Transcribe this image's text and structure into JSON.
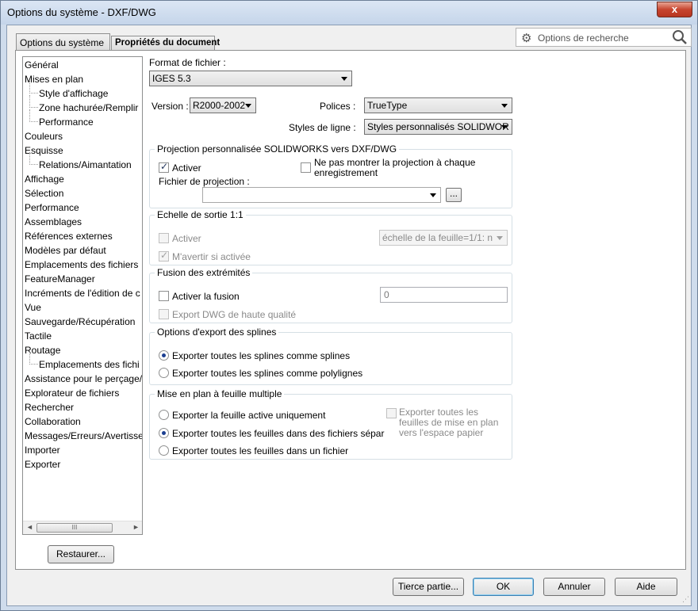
{
  "window": {
    "title": "Options du système - DXF/DWG",
    "close_symbol": "x"
  },
  "tabs": [
    {
      "label": "Options du système",
      "active": true
    },
    {
      "label": "Propriétés du document",
      "active": false
    }
  ],
  "search": {
    "label": "Options de recherche"
  },
  "tree": [
    {
      "label": "Général",
      "child": false
    },
    {
      "label": "Mises en plan",
      "child": false
    },
    {
      "label": "Style d'affichage",
      "child": true
    },
    {
      "label": "Zone hachurée/Remplir",
      "child": true
    },
    {
      "label": "Performance",
      "child": true
    },
    {
      "label": "Couleurs",
      "child": false
    },
    {
      "label": "Esquisse",
      "child": false
    },
    {
      "label": "Relations/Aimantation",
      "child": true
    },
    {
      "label": "Affichage",
      "child": false
    },
    {
      "label": "Sélection",
      "child": false
    },
    {
      "label": "Performance",
      "child": false
    },
    {
      "label": "Assemblages",
      "child": false
    },
    {
      "label": "Références externes",
      "child": false
    },
    {
      "label": "Modèles par défaut",
      "child": false
    },
    {
      "label": "Emplacements des fichiers",
      "child": false
    },
    {
      "label": "FeatureManager",
      "child": false
    },
    {
      "label": "Incréments de l'édition de c",
      "child": false
    },
    {
      "label": "Vue",
      "child": false
    },
    {
      "label": "Sauvegarde/Récupération",
      "child": false
    },
    {
      "label": "Tactile",
      "child": false
    },
    {
      "label": "Routage",
      "child": false
    },
    {
      "label": "Emplacements des fichi",
      "child": true
    },
    {
      "label": "Assistance pour le perçage/",
      "child": false
    },
    {
      "label": "Explorateur de fichiers",
      "child": false
    },
    {
      "label": "Rechercher",
      "child": false
    },
    {
      "label": "Collaboration",
      "child": false
    },
    {
      "label": "Messages/Erreurs/Avertisser",
      "child": false
    },
    {
      "label": "Importer",
      "child": false
    },
    {
      "label": "Exporter",
      "child": false
    }
  ],
  "scroll": {
    "left": "◄",
    "right": "►",
    "grip": "III"
  },
  "restore_button": "Restaurer...",
  "format": {
    "label": "Format de fichier :",
    "value": "IGES 5.3"
  },
  "version": {
    "label": "Version :",
    "value": "R2000-2002"
  },
  "fonts": {
    "label": "Polices :",
    "value": "TrueType"
  },
  "line_styles": {
    "label": "Styles de ligne :",
    "value": "Styles personnalisés SOLIDWOR"
  },
  "projection": {
    "title": "Projection personnalisée SOLIDWORKS vers DXF/DWG",
    "activate": "Activer",
    "no_show_line1": "Ne pas montrer la projection à chaque",
    "no_show_line2": "enregistrement",
    "file_label": "Fichier de projection :",
    "file_value": "",
    "browse": "..."
  },
  "scale": {
    "title": "Echelle de sortie 1:1",
    "activate": "Activer",
    "warn": "M'avertir si activée",
    "combo": "échelle de la feuille=1/1: n"
  },
  "merge": {
    "title": "Fusion des extrémités",
    "activate": "Activer la fusion",
    "value": "0",
    "hq_export": "Export DWG de haute qualité"
  },
  "splines": {
    "title": "Options d'export des splines",
    "opt1": "Exporter toutes les splines comme splines",
    "opt2": "Exporter toutes les splines comme polylignes"
  },
  "multisheet": {
    "title": "Mise en plan à feuille multiple",
    "opt1": "Exporter la feuille active uniquement",
    "opt2": "Exporter toutes les feuilles dans des fichiers sépar",
    "opt3": "Exporter toutes les feuilles dans un fichier",
    "paper_line1": "Exporter toutes les",
    "paper_line2": "feuilles de mise en plan",
    "paper_line3": "vers l'espace papier"
  },
  "footer": {
    "third_party": "Tierce partie...",
    "ok": "OK",
    "cancel": "Annuler",
    "help": "Aide"
  }
}
